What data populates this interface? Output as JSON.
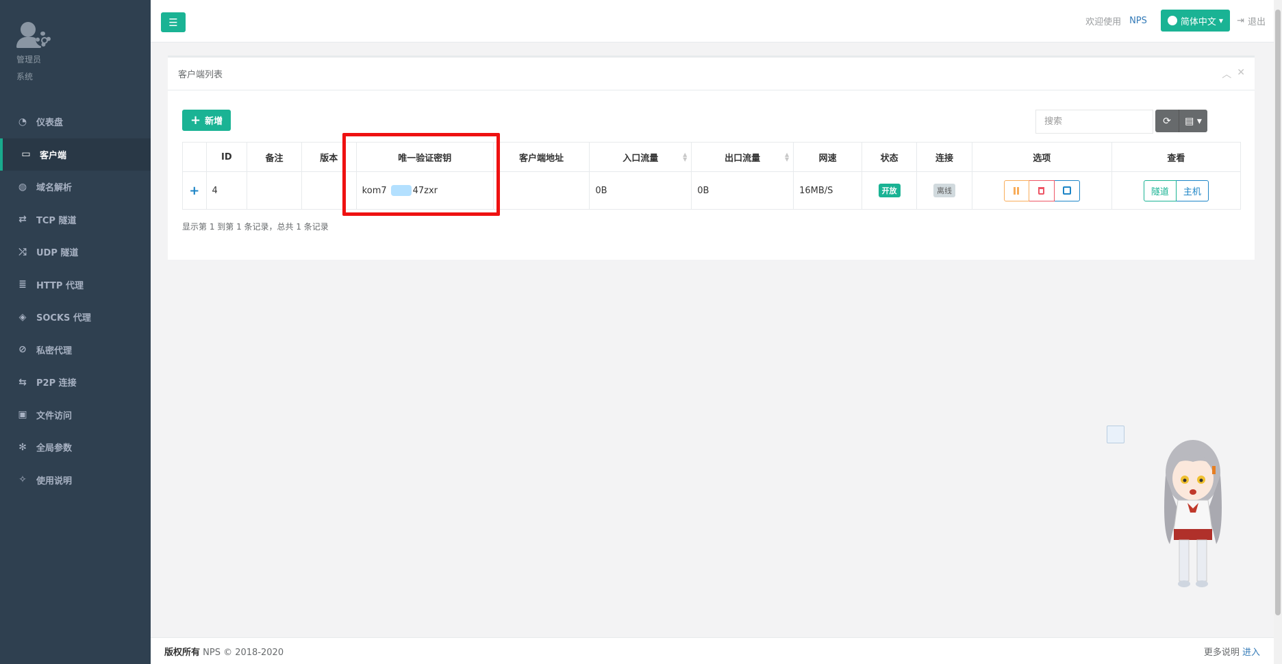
{
  "sidebar": {
    "profile": {
      "line1": "管理员",
      "line2": "系统"
    },
    "items": [
      {
        "label": "仪表盘",
        "icon": "dashboard-icon",
        "glyph": "◔"
      },
      {
        "label": "客户端",
        "icon": "monitor-icon",
        "glyph": "▭",
        "active": true
      },
      {
        "label": "域名解析",
        "icon": "globe-icon",
        "glyph": "◍"
      },
      {
        "label": "TCP 隧道",
        "icon": "retweet-icon",
        "glyph": "⇄"
      },
      {
        "label": "UDP 隧道",
        "icon": "random-icon",
        "glyph": "⤮"
      },
      {
        "label": "HTTP 代理",
        "icon": "server-icon",
        "glyph": "≣"
      },
      {
        "label": "SOCKS 代理",
        "icon": "layers-icon",
        "glyph": "◈"
      },
      {
        "label": "私密代理",
        "icon": "eye-slash-icon",
        "glyph": "⊘"
      },
      {
        "label": "P2P 连接",
        "icon": "exchange-icon",
        "glyph": "⇆"
      },
      {
        "label": "文件访问",
        "icon": "briefcase-icon",
        "glyph": "▣"
      },
      {
        "label": "全局参数",
        "icon": "cog-icon",
        "glyph": "✻"
      },
      {
        "label": "使用说明",
        "icon": "lightbulb-icon",
        "glyph": "✧"
      }
    ]
  },
  "topbar": {
    "welcome": "欢迎使用",
    "app_name": "NPS",
    "language": "简体中文",
    "logout": "退出"
  },
  "panel": {
    "title": "客户端列表",
    "add_button": "新增",
    "search_placeholder": "搜索"
  },
  "table": {
    "headers": [
      "ID",
      "备注",
      "版本",
      "唯一验证密钥",
      "客户端地址",
      "入口流量",
      "出口流量",
      "网速",
      "状态",
      "连接",
      "选项",
      "查看"
    ],
    "row": {
      "expand": "+",
      "id": "4",
      "remark": "",
      "version": "",
      "key_prefix": "kom7",
      "key_suffix": "47zxr",
      "address": "",
      "in_flow": "0B",
      "out_flow": "0B",
      "speed": "16MB/S",
      "status": "开放",
      "connection": "离线",
      "view_tunnel": "隧道",
      "view_host": "主机"
    },
    "pagination": "显示第 1 到第 1 条记录，总共 1 条记录"
  },
  "footer": {
    "copyright_label": "版权所有",
    "copyright_text": "NPS © 2018-2020",
    "more_label": "更多说明",
    "more_link": "进入"
  },
  "colors": {
    "sidebar_bg": "#2f4050",
    "accent": "#1ab394",
    "highlight": "#ee1111"
  }
}
